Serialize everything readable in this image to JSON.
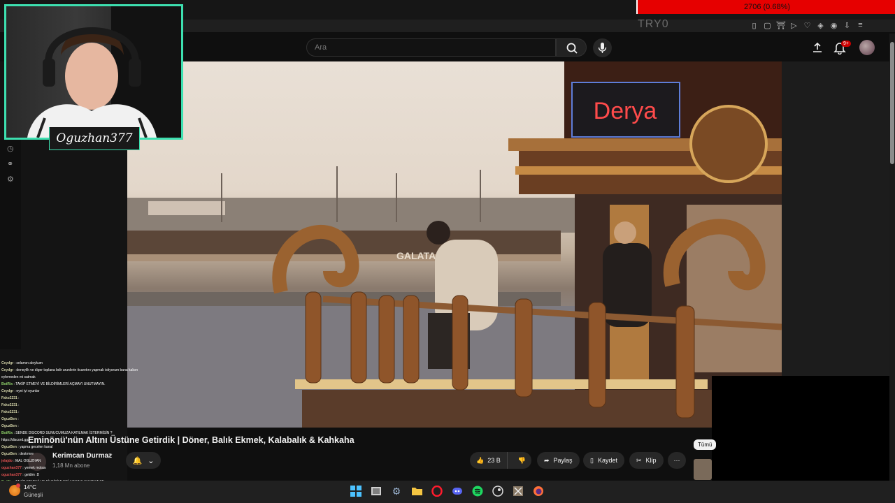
{
  "browser": {
    "tab_title": "TRY0",
    "bits_text": "2706 (0.68%)",
    "extension_icons": [
      "bookmark-icon",
      "screenshot-icon",
      "shield-icon",
      "play-icon",
      "heart-icon",
      "extensions-icon",
      "profile-icon",
      "download-icon",
      "menu-icon"
    ]
  },
  "header": {
    "search_placeholder": "Ara",
    "notifications_badge": "9+"
  },
  "webcam": {
    "name": "Oguzhan377"
  },
  "video": {
    "title": "Eminönü'nün Altını Üstüne Getirdik | Döner, Balık Ekmek, Kalabalık & Kahkaha",
    "boat_sign": "Derya",
    "bridge_sign": "GALATA",
    "channel_name": "Kerimcan Durmaz",
    "subscribers": "1,18 Mn abone",
    "likes": "23 B",
    "share_label": "Paylaş",
    "save_label": "Kaydet",
    "clip_label": "Klip",
    "chip_label": "Tümü"
  },
  "chat": [
    {
      "user": "Ceydgr",
      "text": ": selamın aleykum",
      "color": ""
    },
    {
      "user": "Ceydgr",
      "text": ": deneylik ve diger toplana bdir urunlerin ticaretını yapmak istiyorum bana kalsın",
      "color": ""
    },
    {
      "user": "",
      "text": "eylemeden mi satmak",
      "color": ""
    },
    {
      "user": "BotRix",
      "text": ": TAKİP ETMEYİ VE BİLDİRİMLERİ AÇMAYI UNUTMAYIN.",
      "color": "green"
    },
    {
      "user": "Ceydgr",
      "text": ": eyni iyi oyunlar",
      "color": ""
    },
    {
      "user": "Fako2231",
      "text": ":",
      "color": ""
    },
    {
      "user": "Fako2231",
      "text": ":",
      "color": ""
    },
    {
      "user": "Fako2231",
      "text": ":",
      "color": ""
    },
    {
      "user": "OguzBen",
      "text": ":",
      "color": ""
    },
    {
      "user": "OguzBen",
      "text": ":",
      "color": ""
    },
    {
      "user": "BotRix",
      "text": ": SENDE DISCORD SUNUCUMUZA KATILMAK İSTERMİSİN ?",
      "color": "green"
    },
    {
      "user": "",
      "text": "https://discord.gg/",
      "color": ""
    },
    {
      "user": "OguzBen",
      "text": ": yapma gecelen kanal",
      "color": ""
    },
    {
      "user": "OguzBen",
      "text": ": destrmre",
      "color": ""
    },
    {
      "user": "jelajdo",
      "text": ": MAL OGUZHAN",
      "color": "red"
    },
    {
      "user": "oguzhan377",
      "text": ": yemek molası",
      "color": "red"
    },
    {
      "user": "oguzhan377",
      "text": ": geldim :D",
      "color": "red"
    },
    {
      "user": "BotRix",
      "text": ": TAKİP ETMEYİ VE BİLDİRİMLERİ AÇMAYI UNUTMAYIN.",
      "color": "green"
    }
  ],
  "taskbar": {
    "temperature": "14°C",
    "weather": "Güneşli",
    "apps": [
      "windows-start-icon",
      "file-manager-icon",
      "settings-icon",
      "folder-icon",
      "opera-icon",
      "discord-icon",
      "spotify-icon",
      "steam-icon",
      "game-icon",
      "firefox-icon"
    ]
  }
}
